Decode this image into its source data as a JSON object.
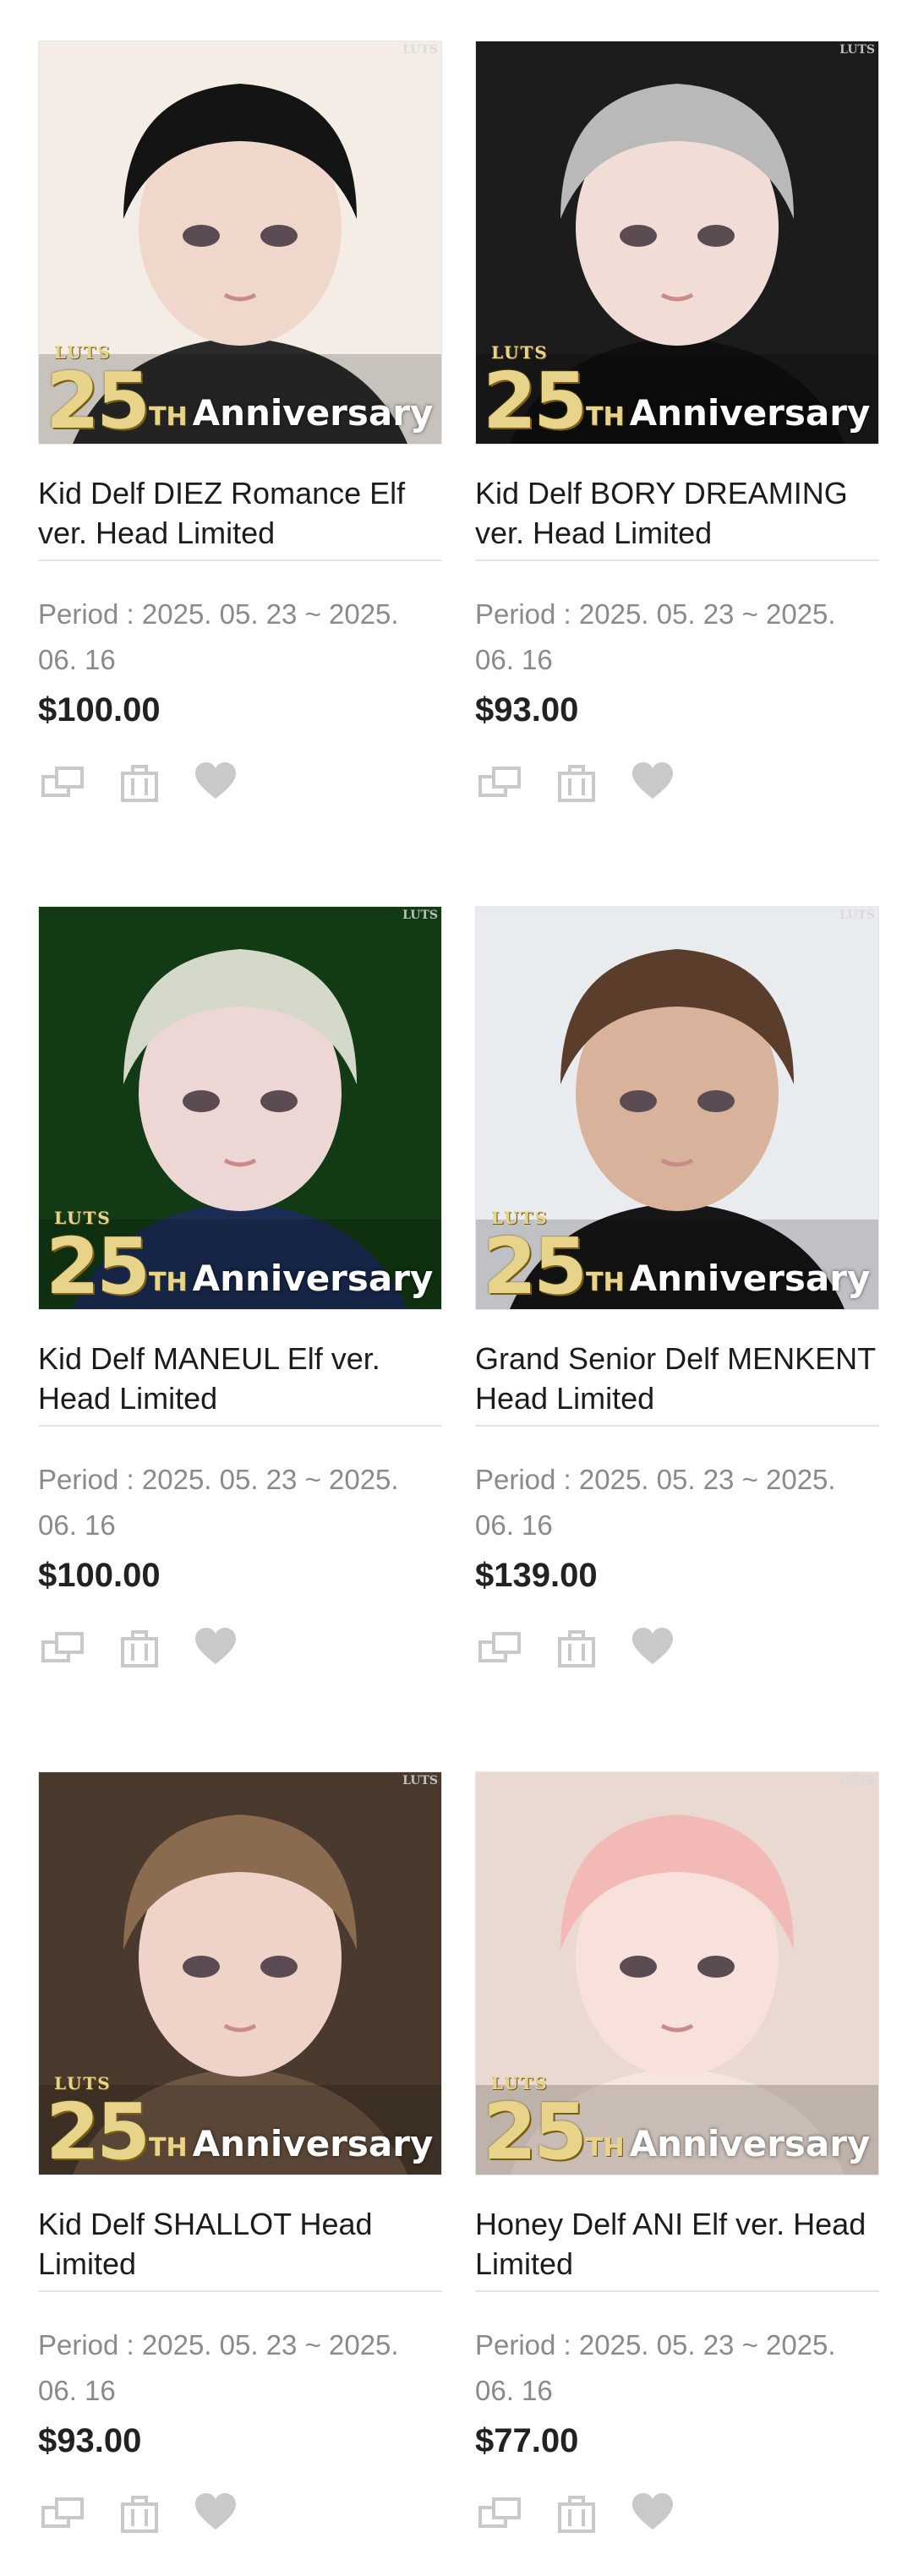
{
  "products": [
    {
      "name": "Kid Delf DIEZ Romance Elf ver. Head Limited",
      "period": "Period : 2025. 05. 23 ~ 2025. 06. 16",
      "price": "$100.00",
      "badge": {
        "number": "25",
        "suffix": "TH",
        "label": "Anniversary",
        "logo": "LUTS"
      },
      "image_theme": {
        "bg": "#f3ede6",
        "hair": "#141414",
        "skin": "#f0d7cc",
        "outfit": "#2b2b2b"
      }
    },
    {
      "name": "Kid Delf BORY DREAMING ver. Head Limited",
      "period": "Period : 2025. 05. 23 ~ 2025. 06. 16",
      "price": "$93.00",
      "badge": {
        "number": "25",
        "suffix": "TH",
        "label": "Anniversary",
        "logo": "LUTS"
      },
      "image_theme": {
        "bg": "#1c1c1c",
        "hair": "#b9b9b9",
        "skin": "#f1ddd5",
        "outfit": "#0f0f0f"
      }
    },
    {
      "name": "Kid Delf MANEUL Elf ver. Head Limited",
      "period": "Period : 2025. 05. 23 ~ 2025. 06. 16",
      "price": "$100.00",
      "badge": {
        "number": "25",
        "suffix": "TH",
        "label": "Anniversary",
        "logo": "LUTS"
      },
      "image_theme": {
        "bg": "#123a14",
        "hair": "#d3d8c8",
        "skin": "#ecd7d4",
        "outfit": "#1b2c55"
      }
    },
    {
      "name": "Grand Senior Delf MENKENT Head Limited",
      "period": "Period : 2025. 05. 23 ~ 2025. 06. 16",
      "price": "$139.00",
      "badge": {
        "number": "25",
        "suffix": "TH",
        "label": "Anniversary",
        "logo": "LUTS"
      },
      "image_theme": {
        "bg": "#e9ecef",
        "hair": "#5a3d2b",
        "skin": "#d9b29c",
        "outfit": "#161616"
      }
    },
    {
      "name": "Kid Delf SHALLOT Head Limited",
      "period": "Period : 2025. 05. 23 ~ 2025. 06. 16",
      "price": "$93.00",
      "badge": {
        "number": "25",
        "suffix": "TH",
        "label": "Anniversary",
        "logo": "LUTS"
      },
      "image_theme": {
        "bg": "#4a3a2d",
        "hair": "#8b6b50",
        "skin": "#f0d3c8",
        "outfit": "#6d5644"
      }
    },
    {
      "name": "Honey Delf ANI Elf ver. Head Limited",
      "period": "Period : 2025. 05. 23 ~ 2025. 06. 16",
      "price": "$77.00",
      "badge": {
        "number": "25",
        "suffix": "TH",
        "label": "Anniversary",
        "logo": "LUTS"
      },
      "image_theme": {
        "bg": "#ead9d0",
        "hair": "#f2b9b6",
        "skin": "#f7e1da",
        "outfit": "#f4e6dd"
      }
    }
  ],
  "actions": [
    {
      "icon": "compare-icon"
    },
    {
      "icon": "cart-icon"
    },
    {
      "icon": "heart-icon"
    }
  ],
  "colors": {
    "icon": "#c9c9c9",
    "divider": "#e3e3e3",
    "period": "#8a8a8a"
  }
}
